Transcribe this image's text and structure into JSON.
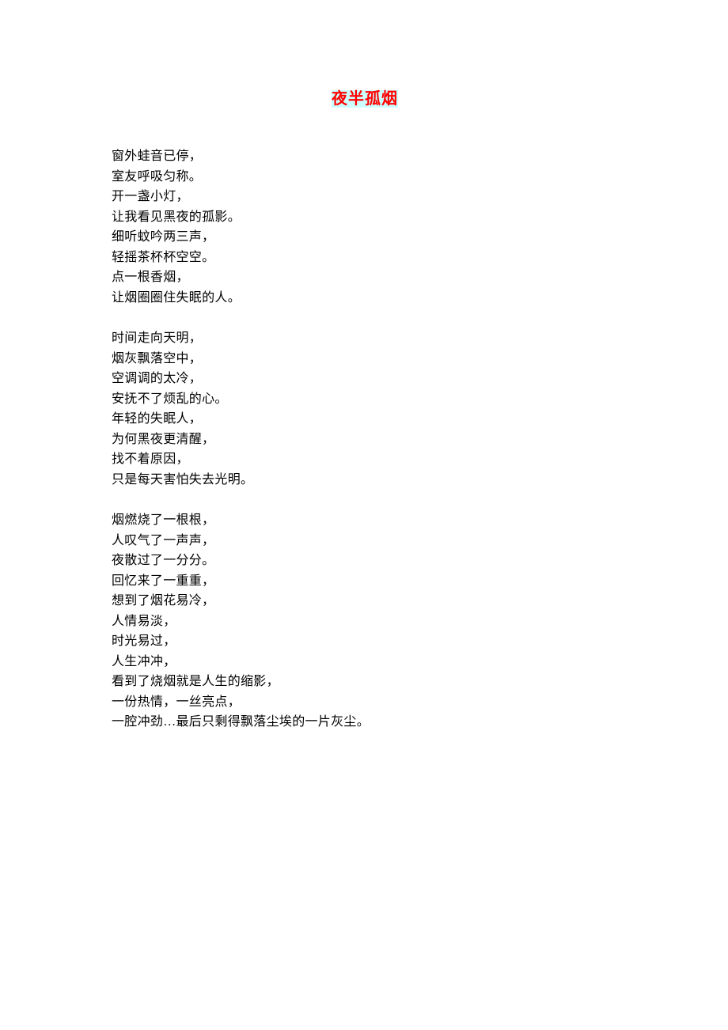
{
  "title": "夜半孤烟",
  "stanzas": [
    {
      "lines": [
        "窗外蛙音已停，",
        "室友呼吸匀称。",
        "开一盏小灯，",
        "让我看见黑夜的孤影。",
        "细听蚊吟两三声，",
        "轻摇茶杯杯空空。",
        "点一根香烟，",
        "让烟圈圈住失眠的人。"
      ]
    },
    {
      "lines": [
        "时间走向天明，",
        "烟灰飘落空中，",
        "空调调的太冷，",
        "安抚不了烦乱的心。",
        "年轻的失眠人，",
        "为何黑夜更清醒，",
        "找不着原因，",
        "只是每天害怕失去光明。"
      ]
    },
    {
      "lines": [
        "烟燃烧了一根根，",
        "人叹气了一声声，",
        "夜散过了一分分。",
        "回忆来了一重重，",
        "想到了烟花易冷，",
        "人情易淡，",
        "时光易过，",
        "人生冲冲，",
        "看到了烧烟就是人生的缩影，",
        "一份热情，一丝亮点，",
        "一腔冲劲…最后只剩得飘落尘埃的一片灰尘。"
      ]
    }
  ]
}
